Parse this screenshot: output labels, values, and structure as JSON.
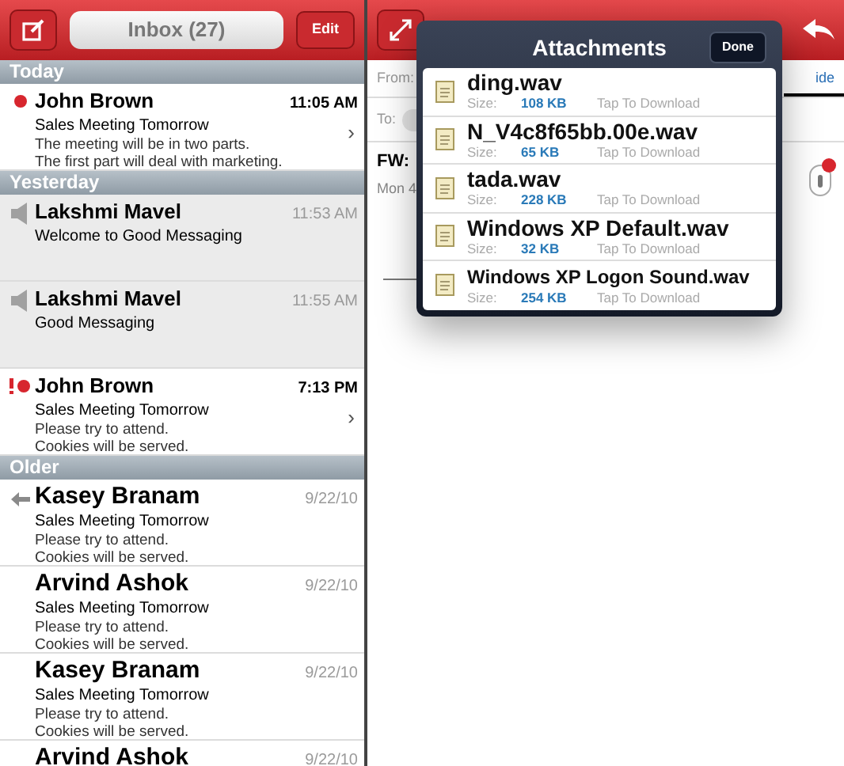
{
  "inbox": {
    "title": "Inbox (27)",
    "edit_button": "Edit",
    "sections": [
      {
        "title": "Today",
        "rows": [
          {
            "kind": "unread",
            "sender": "John Brown",
            "time": "11:05 AM",
            "subject": "Sales Meeting Tomorrow",
            "preview": [
              "The meeting will be in two parts.",
              "The first part will deal with marketing."
            ],
            "chevron": "›",
            "highlighted": false
          }
        ]
      },
      {
        "title": "Yesterday",
        "rows": [
          {
            "kind": "audio",
            "sender": "Lakshmi Mavel",
            "time": "11:53 AM",
            "subject": "Welcome to Good Messaging",
            "preview": [],
            "highlighted": true
          },
          {
            "kind": "audio",
            "sender": "Lakshmi Mavel",
            "time": "11:55 AM",
            "subject": "Good Messaging",
            "preview": [],
            "highlighted": true
          },
          {
            "kind": "urgent",
            "sender": "John Brown",
            "time": "7:13 PM",
            "subject": "Sales Meeting Tomorrow",
            "preview": [
              "Please try to attend.",
              "Cookies will be served."
            ],
            "chevron": "›",
            "highlighted": false
          }
        ]
      },
      {
        "title": "Older",
        "rows": [
          {
            "kind": "replied",
            "sender": "Kasey Branam",
            "time": "9/22/10",
            "subject": "Sales Meeting Tomorrow",
            "preview": [
              "Please try to attend.",
              "Cookies will be served."
            ],
            "highlighted": false
          },
          {
            "kind": "plain",
            "sender": "Arvind Ashok",
            "time": "9/22/10",
            "subject": "Sales Meeting Tomorrow",
            "preview": [
              "Please try to attend.",
              "Cookies will be served."
            ],
            "highlighted": false
          },
          {
            "kind": "plain",
            "sender": "Kasey Branam",
            "time": "9/22/10",
            "subject": "Sales Meeting Tomorrow",
            "preview": [
              "Please try to attend.",
              "Cookies will be served."
            ],
            "highlighted": false
          },
          {
            "kind": "plain",
            "sender": "Arvind Ashok",
            "time": "9/22/10",
            "subject": "",
            "preview": [],
            "highlighted": false
          }
        ]
      }
    ]
  },
  "message": {
    "from_label": "From:",
    "to_label": "To:",
    "link": "ide",
    "subject": "FW:",
    "date": "Mon 4"
  },
  "attachments": {
    "title": "Attachments",
    "done_button": "Done",
    "files": [
      {
        "name": "ding.wav",
        "size_label": "Size:",
        "size": "108 KB",
        "action": "Tap To Download"
      },
      {
        "name": "N_V4c8f65bb.00e.wav",
        "size_label": "Size:",
        "size": "65 KB",
        "action": "Tap To Download"
      },
      {
        "name": "tada.wav",
        "size_label": "Size:",
        "size": "228 KB",
        "action": "Tap To Download"
      },
      {
        "name": "Windows XP Default.wav",
        "size_label": "Size:",
        "size": "32 KB",
        "action": "Tap To Download"
      },
      {
        "name": "Windows XP Logon Sound.wav",
        "size_label": "Size:",
        "size": "254 KB",
        "action": "Tap To Download"
      }
    ]
  }
}
